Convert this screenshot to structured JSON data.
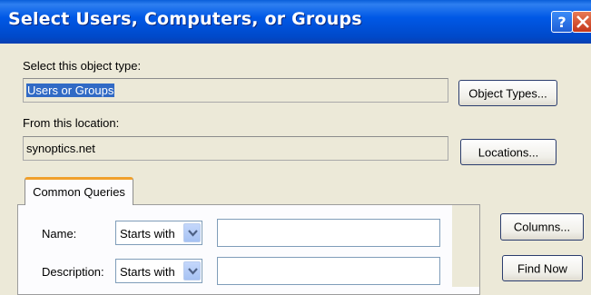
{
  "dialog": {
    "title": "Select Users, Computers, or Groups",
    "help_glyph": "?",
    "close_glyph": "X"
  },
  "object_type": {
    "label": "Select this object type:",
    "value": "Users or Groups",
    "button": "Object Types..."
  },
  "location": {
    "label": "From this location:",
    "value": "synoptics.net",
    "button": "Locations..."
  },
  "tabs": [
    {
      "label": "Common Queries"
    }
  ],
  "queries": {
    "name_label": "Name:",
    "name_operator": "Starts with",
    "name_value": "",
    "description_label": "Description:",
    "description_operator": "Starts with",
    "description_value": ""
  },
  "side_buttons": {
    "columns": "Columns...",
    "find_now": "Find Now"
  },
  "colors": {
    "titlebar": "#0058e6",
    "dialog_bg": "#ece9d8",
    "selection": "#316ac5",
    "tab_accent": "#f0a02c",
    "close_button": "#c4361a"
  }
}
